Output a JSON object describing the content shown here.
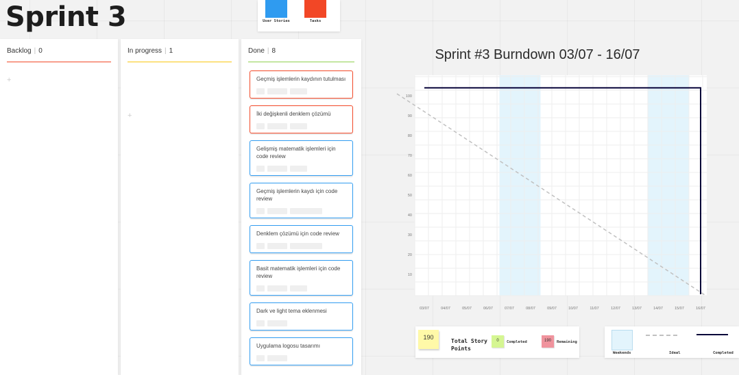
{
  "page": {
    "title": "Sprint 3"
  },
  "legend": {
    "items": [
      {
        "label": "User Stories",
        "color": "#2f9bf0"
      },
      {
        "label": "Tasks",
        "color": "#f24726"
      }
    ]
  },
  "columns": [
    {
      "name": "Backlog",
      "count": "0",
      "color": "#f24726",
      "cards": []
    },
    {
      "name": "In progress",
      "count": "1",
      "color": "#fac710",
      "cards": []
    },
    {
      "name": "Done",
      "count": "8",
      "color": "#8fd14f",
      "cards": [
        {
          "text": "Geçmiş işlemlerin kaydının tutulması",
          "type": "task"
        },
        {
          "text": "İki değişkenli denklem çözümü",
          "type": "task"
        },
        {
          "text": "Gelişmiş matematik işlemleri için code review",
          "type": "story"
        },
        {
          "text": "Geçmiş işlemlerin kaydı için code review",
          "type": "story"
        },
        {
          "text": "Denklem çözümü için code review",
          "type": "story"
        },
        {
          "text": "Basit matematik işlemleri için code review",
          "type": "story"
        },
        {
          "text": "Dark ve light tema eklenmesi",
          "type": "story"
        },
        {
          "text": "Uygulama logosu tasarımı",
          "type": "story"
        }
      ]
    }
  ],
  "chart_data": {
    "type": "line",
    "title": "Sprint #3 Burndown 03/07 - 16/07",
    "categories": [
      "03/07",
      "04/07",
      "05/07",
      "06/07",
      "07/07",
      "08/07",
      "09/07",
      "10/07",
      "11/07",
      "12/07",
      "13/07",
      "14/07",
      "15/07",
      "16/07"
    ],
    "yticks": [
      10,
      20,
      30,
      40,
      50,
      60,
      70,
      80,
      90,
      100
    ],
    "ylim": [
      0,
      100
    ],
    "weekends": [
      [
        "07/07",
        "08/07"
      ],
      [
        "14/07",
        "15/07"
      ]
    ],
    "series": [
      {
        "name": "Ideal",
        "style": "dashed",
        "color": "#c0c0c0",
        "x": [
          "03/07",
          "16/07"
        ],
        "y": [
          100,
          0
        ]
      },
      {
        "name": "Completed",
        "style": "solid",
        "color": "#050038",
        "x": [
          "03/07",
          "16/07",
          "16/07"
        ],
        "y": [
          104,
          104,
          0
        ]
      }
    ],
    "legend": {
      "weekends": "Weekends",
      "ideal": "Ideal",
      "completed": "Completed"
    },
    "weekend_color": "#e3f4fc"
  },
  "story_points": {
    "total": "190",
    "label_line1": "Total Story",
    "label_line2": "Points",
    "completed_value": "0",
    "completed_label": "Completed",
    "remaining_value": "190",
    "remaining_label": "Remaining"
  }
}
